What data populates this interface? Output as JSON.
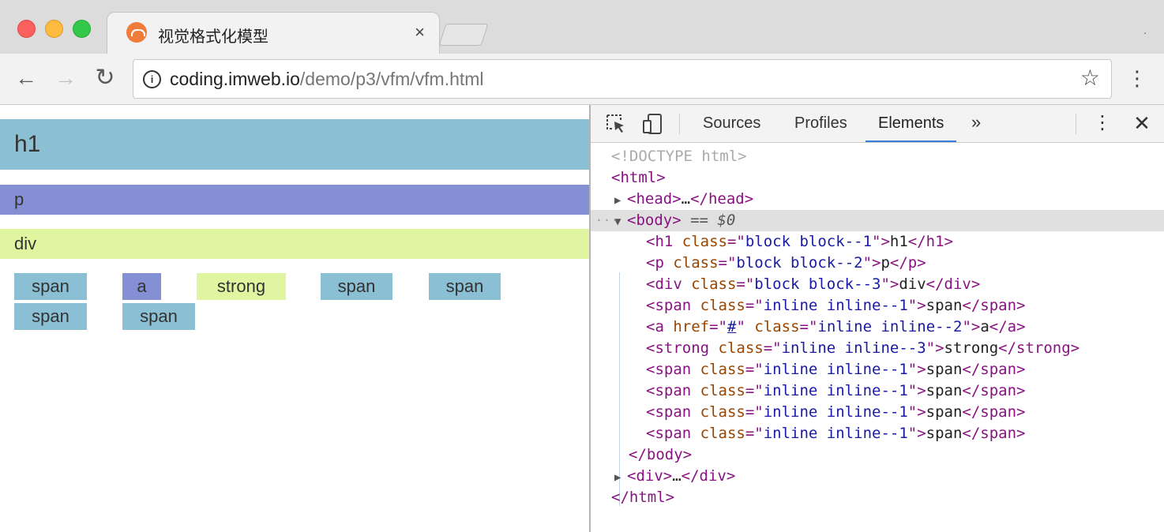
{
  "browser": {
    "tab_title": "视觉格式化模型",
    "tab_close": "×",
    "overflow_dot": ".",
    "url_host": "coding.imweb.io",
    "url_path": "/demo/p3/vfm/vfm.html",
    "nav": {
      "back": "←",
      "forward": "→",
      "reload": "↻",
      "menu": "⋮",
      "star": "☆",
      "info": "i"
    }
  },
  "page": {
    "blocks": [
      {
        "label": "h1",
        "color": "#8bbfd4"
      },
      {
        "label": "p",
        "color": "#8590d4"
      },
      {
        "label": "div",
        "color": "#dff5a0"
      }
    ],
    "inlines": [
      {
        "label": "span",
        "color": "#8bbfd4"
      },
      {
        "label": "a",
        "color": "#8590d4"
      },
      {
        "label": "strong",
        "color": "#dff5a0"
      },
      {
        "label": "span",
        "color": "#8bbfd4"
      },
      {
        "label": "span",
        "color": "#8bbfd4"
      },
      {
        "label": "span",
        "color": "#8bbfd4"
      },
      {
        "label": "span",
        "color": "#8bbfd4"
      }
    ]
  },
  "devtools": {
    "tabs": [
      "Sources",
      "Profiles",
      "Elements"
    ],
    "active_tab": "Elements",
    "more": "»",
    "kebab": "⋮",
    "close": "✕",
    "tree": {
      "doctype": "<!DOCTYPE html>",
      "html_open": "<html>",
      "head_open": "<head>",
      "ellipsis": "…",
      "head_close": "</head>",
      "body_open": "<body>",
      "body_eq": " == ",
      "body_ref": "$0",
      "rows": [
        {
          "tag": "h1",
          "href": null,
          "cls": "block block--1",
          "text": "h1"
        },
        {
          "tag": "p",
          "href": null,
          "cls": "block block--2",
          "text": "p"
        },
        {
          "tag": "div",
          "href": null,
          "cls": "block block--3",
          "text": "div"
        },
        {
          "tag": "span",
          "href": null,
          "cls": "inline inline--1",
          "text": "span"
        },
        {
          "tag": "a",
          "href": "#",
          "cls": "inline inline--2",
          "text": "a"
        },
        {
          "tag": "strong",
          "href": null,
          "cls": "inline inline--3",
          "text": "strong"
        },
        {
          "tag": "span",
          "href": null,
          "cls": "inline inline--1",
          "text": "span"
        },
        {
          "tag": "span",
          "href": null,
          "cls": "inline inline--1",
          "text": "span"
        },
        {
          "tag": "span",
          "href": null,
          "cls": "inline inline--1",
          "text": "span"
        },
        {
          "tag": "span",
          "href": null,
          "cls": "inline inline--1",
          "text": "span"
        }
      ],
      "body_close": "</body>",
      "div_open": "<div>",
      "div_close": "</div>",
      "html_close": "</html>"
    }
  }
}
